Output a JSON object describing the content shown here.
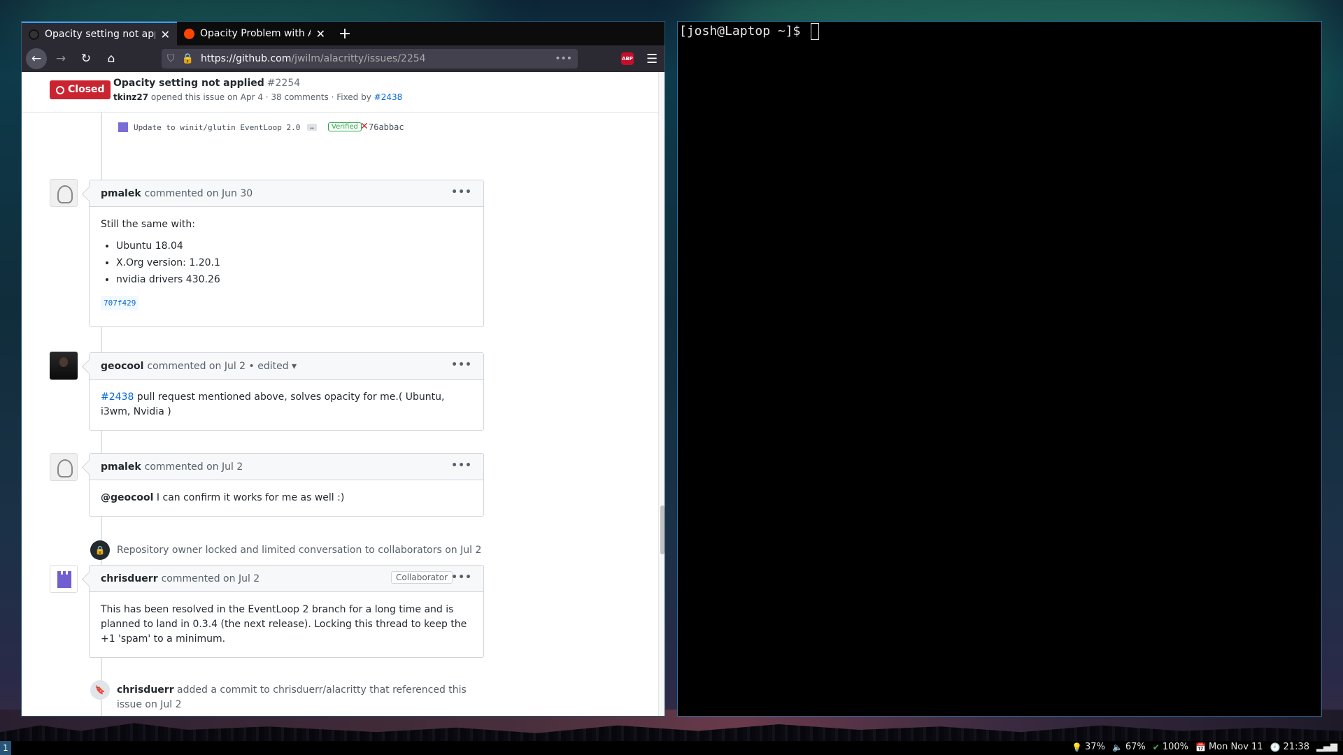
{
  "browser": {
    "tabs": [
      {
        "title": "Opacity setting not applie",
        "active": true
      },
      {
        "title": "Opacity Problem with Al",
        "active": false
      }
    ],
    "new_tab": "+",
    "url_domain": "https://github.com",
    "url_path": "/jwilm/alacritty/issues/2254",
    "more_actions": "•••",
    "abp_label": "ABP",
    "menu": "☰"
  },
  "issue": {
    "state": "Closed",
    "title": "Opacity setting not applied",
    "number": "#2254",
    "author": "tkinz27",
    "meta_mid": " opened this issue on Apr 4 · 38 comments · Fixed by ",
    "fixed_by": "#2438"
  },
  "commit_ref": {
    "message": "Update to winit/glutin EventLoop 2.0",
    "ellipsis": "…",
    "verified": "Verified",
    "sha": "76abbac"
  },
  "comments": [
    {
      "author": "pmalek",
      "action": "commented on Jun 30",
      "body_intro": "Still the same with:",
      "list": [
        "Ubuntu 18.04",
        "X.Org version: 1.20.1",
        "nvidia drivers 430.26"
      ],
      "chip": "707f429"
    },
    {
      "author": "geocool",
      "action": "commented on Jul 2 • edited ▾",
      "link": "#2438",
      "body": " pull request mentioned above, solves opacity for me.( Ubuntu, i3wm, Nvidia )"
    },
    {
      "author": "pmalek",
      "action": "commented on Jul 2",
      "mention": "@geocool",
      "body": " I can confirm it works for me as well :)"
    },
    {
      "author": "chrisduerr",
      "action": "commented on Jul 2",
      "badge": "Collaborator",
      "body": "This has been resolved in the EventLoop 2 branch for a long time and is planned to land in 0.3.4 (the next release). Locking this thread to keep the +1 'spam' to a minimum."
    }
  ],
  "events": {
    "locked": "Repository owner locked and limited conversation to collaborators on Jul 2",
    "commit_author": "chrisduerr",
    "commit_text": " added a commit to chrisduerr/alacritty that referenced this issue on Jul 2"
  },
  "comment_more": "•••",
  "terminal": {
    "prompt": "[josh@Laptop ~]$ "
  },
  "statusbar": {
    "workspace": "1",
    "brightness": "37%",
    "volume": "67%",
    "battery": "100%",
    "date": "Mon Nov 11",
    "time": "21:38"
  },
  "colors": {
    "closed": "#cb2431",
    "link": "#0366d6",
    "accent_tab": "#3d9be9"
  }
}
